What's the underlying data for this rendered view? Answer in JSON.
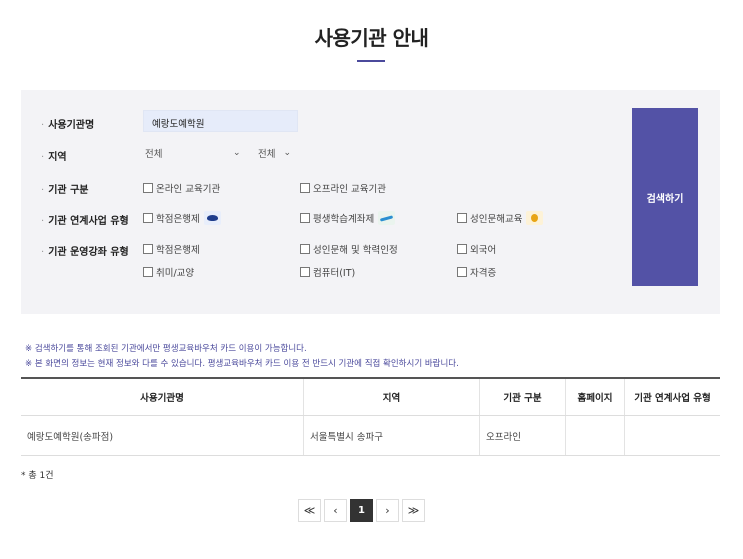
{
  "page": {
    "title": "사용기관 안내"
  },
  "search": {
    "labels": {
      "name": "사용기관명",
      "region": "지역",
      "type": "기관 구분",
      "linked": "기관 연계사업 유형",
      "course": "기관 운영강좌 유형"
    },
    "name_value": "예랑도예학원",
    "region_select_1": "전체",
    "region_select_2": "전체",
    "type_options": [
      "온라인 교육기관",
      "오프라인 교육기관"
    ],
    "linked_options": [
      "학점은행제",
      "평생학습계좌제",
      "성인문해교육"
    ],
    "course_options": [
      "학점은행제",
      "성인문해 및 학력인정",
      "외국어",
      "취미/교양",
      "컴퓨터(IT)",
      "자격증"
    ],
    "button_label": "검색하기"
  },
  "notices": [
    "※ 검색하기를 통해 조회된 기관에서만 평생교육바우처 카드 이용이 가능합니다.",
    "※ 본 화면의 정보는 현재 정보와 다를 수 있습니다. 평생교육바우처 카드 이용 전 반드시 기관에 직접 확인하시기 바랍니다."
  ],
  "table": {
    "headers": [
      "사용기관명",
      "지역",
      "기관 구분",
      "홈페이지",
      "기관 연계사업 유형"
    ],
    "rows": [
      [
        "예랑도예학원(송파점)",
        "서울특별시 송파구",
        "오프라인",
        "",
        ""
      ]
    ]
  },
  "total": "* 총 1건",
  "pagination": {
    "first": "≪",
    "prev": "‹",
    "current": "1",
    "next": "›",
    "last": "≫"
  }
}
